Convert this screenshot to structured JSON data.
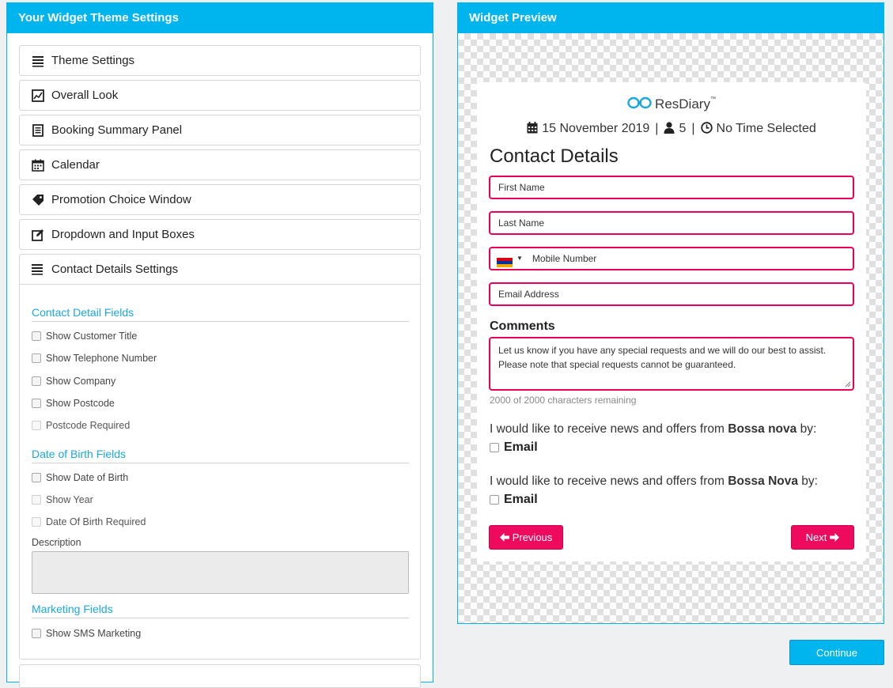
{
  "settings_panel": {
    "title": "Your Widget Theme Settings",
    "accordion": [
      {
        "label": "Theme Settings",
        "icon": "list-icon"
      },
      {
        "label": "Overall Look",
        "icon": "image-icon"
      },
      {
        "label": "Booking Summary Panel",
        "icon": "receipt-icon"
      },
      {
        "label": "Calendar",
        "icon": "calendar-icon"
      },
      {
        "label": "Promotion Choice Window",
        "icon": "tag-icon"
      },
      {
        "label": "Dropdown and Input Boxes",
        "icon": "edit-icon"
      }
    ],
    "expanded": {
      "label": "Contact Details Settings",
      "icon": "list-icon",
      "sections": {
        "contact_fields": {
          "title": "Contact Detail Fields",
          "options": [
            {
              "label": "Show Customer Title",
              "checked": false,
              "disabled": false
            },
            {
              "label": "Show Telephone Number",
              "checked": false,
              "disabled": false
            },
            {
              "label": "Show Company",
              "checked": false,
              "disabled": false
            },
            {
              "label": "Show Postcode",
              "checked": false,
              "disabled": false
            },
            {
              "label": "Postcode Required",
              "checked": false,
              "disabled": true
            }
          ]
        },
        "dob_fields": {
          "title": "Date of Birth Fields",
          "options": [
            {
              "label": "Show Date of Birth",
              "checked": false,
              "disabled": false
            },
            {
              "label": "Show Year",
              "checked": false,
              "disabled": true
            },
            {
              "label": "Date Of Birth Required",
              "checked": false,
              "disabled": true
            }
          ],
          "description_label": "Description",
          "description_value": ""
        },
        "marketing_fields": {
          "title": "Marketing Fields",
          "options": [
            {
              "label": "Show SMS Marketing",
              "checked": false,
              "disabled": false
            }
          ]
        }
      }
    }
  },
  "preview_panel": {
    "title": "Widget Preview",
    "logo_text": "ResDiary",
    "logo_tm": "™",
    "summary": {
      "date": "15 November 2019",
      "covers": "5",
      "time": "No Time Selected"
    },
    "form_title": "Contact Details",
    "fields": {
      "first_name": "First Name",
      "last_name": "Last Name",
      "mobile": "Mobile Number",
      "email": "Email Address"
    },
    "comments": {
      "label": "Comments",
      "placeholder_line1": "Let us know if you have any special requests and we will do our best to assist.",
      "placeholder_line2": "Please note that special requests cannot be guaranteed.",
      "remaining": "2000 of 2000 characters remaining"
    },
    "marketing": [
      {
        "prefix": "I would like to receive news and offers from ",
        "venue": "Bossa nova",
        "suffix": " by:",
        "option": "Email",
        "checked": false
      },
      {
        "prefix": "I would like to receive news and offers from ",
        "venue": "Bossa Nova",
        "suffix": " by:",
        "option": "Email",
        "checked": false
      }
    ],
    "buttons": {
      "previous": "Previous",
      "next": "Next"
    }
  },
  "footer": {
    "continue": "Continue"
  },
  "colors": {
    "accent": "#00b4ee",
    "brand_pink": "#e8005a",
    "section_title": "#1ba8dd"
  }
}
